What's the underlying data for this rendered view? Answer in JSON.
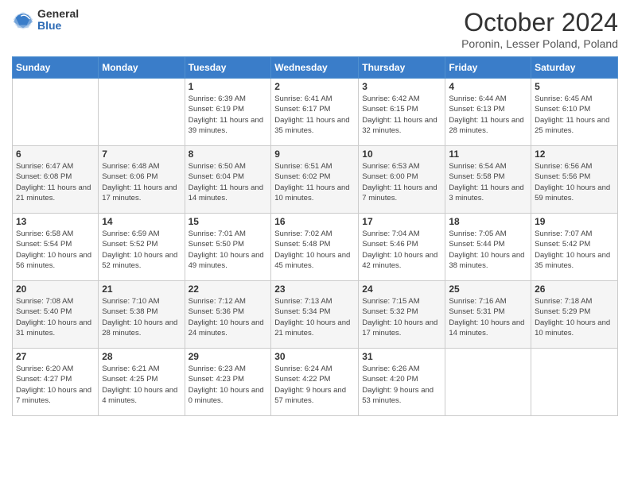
{
  "header": {
    "logo_general": "General",
    "logo_blue": "Blue",
    "month_title": "October 2024",
    "location": "Poronin, Lesser Poland, Poland"
  },
  "weekdays": [
    "Sunday",
    "Monday",
    "Tuesday",
    "Wednesday",
    "Thursday",
    "Friday",
    "Saturday"
  ],
  "weeks": [
    [
      {
        "day": "",
        "info": ""
      },
      {
        "day": "",
        "info": ""
      },
      {
        "day": "1",
        "info": "Sunrise: 6:39 AM\nSunset: 6:19 PM\nDaylight: 11 hours and 39 minutes."
      },
      {
        "day": "2",
        "info": "Sunrise: 6:41 AM\nSunset: 6:17 PM\nDaylight: 11 hours and 35 minutes."
      },
      {
        "day": "3",
        "info": "Sunrise: 6:42 AM\nSunset: 6:15 PM\nDaylight: 11 hours and 32 minutes."
      },
      {
        "day": "4",
        "info": "Sunrise: 6:44 AM\nSunset: 6:13 PM\nDaylight: 11 hours and 28 minutes."
      },
      {
        "day": "5",
        "info": "Sunrise: 6:45 AM\nSunset: 6:10 PM\nDaylight: 11 hours and 25 minutes."
      }
    ],
    [
      {
        "day": "6",
        "info": "Sunrise: 6:47 AM\nSunset: 6:08 PM\nDaylight: 11 hours and 21 minutes."
      },
      {
        "day": "7",
        "info": "Sunrise: 6:48 AM\nSunset: 6:06 PM\nDaylight: 11 hours and 17 minutes."
      },
      {
        "day": "8",
        "info": "Sunrise: 6:50 AM\nSunset: 6:04 PM\nDaylight: 11 hours and 14 minutes."
      },
      {
        "day": "9",
        "info": "Sunrise: 6:51 AM\nSunset: 6:02 PM\nDaylight: 11 hours and 10 minutes."
      },
      {
        "day": "10",
        "info": "Sunrise: 6:53 AM\nSunset: 6:00 PM\nDaylight: 11 hours and 7 minutes."
      },
      {
        "day": "11",
        "info": "Sunrise: 6:54 AM\nSunset: 5:58 PM\nDaylight: 11 hours and 3 minutes."
      },
      {
        "day": "12",
        "info": "Sunrise: 6:56 AM\nSunset: 5:56 PM\nDaylight: 10 hours and 59 minutes."
      }
    ],
    [
      {
        "day": "13",
        "info": "Sunrise: 6:58 AM\nSunset: 5:54 PM\nDaylight: 10 hours and 56 minutes."
      },
      {
        "day": "14",
        "info": "Sunrise: 6:59 AM\nSunset: 5:52 PM\nDaylight: 10 hours and 52 minutes."
      },
      {
        "day": "15",
        "info": "Sunrise: 7:01 AM\nSunset: 5:50 PM\nDaylight: 10 hours and 49 minutes."
      },
      {
        "day": "16",
        "info": "Sunrise: 7:02 AM\nSunset: 5:48 PM\nDaylight: 10 hours and 45 minutes."
      },
      {
        "day": "17",
        "info": "Sunrise: 7:04 AM\nSunset: 5:46 PM\nDaylight: 10 hours and 42 minutes."
      },
      {
        "day": "18",
        "info": "Sunrise: 7:05 AM\nSunset: 5:44 PM\nDaylight: 10 hours and 38 minutes."
      },
      {
        "day": "19",
        "info": "Sunrise: 7:07 AM\nSunset: 5:42 PM\nDaylight: 10 hours and 35 minutes."
      }
    ],
    [
      {
        "day": "20",
        "info": "Sunrise: 7:08 AM\nSunset: 5:40 PM\nDaylight: 10 hours and 31 minutes."
      },
      {
        "day": "21",
        "info": "Sunrise: 7:10 AM\nSunset: 5:38 PM\nDaylight: 10 hours and 28 minutes."
      },
      {
        "day": "22",
        "info": "Sunrise: 7:12 AM\nSunset: 5:36 PM\nDaylight: 10 hours and 24 minutes."
      },
      {
        "day": "23",
        "info": "Sunrise: 7:13 AM\nSunset: 5:34 PM\nDaylight: 10 hours and 21 minutes."
      },
      {
        "day": "24",
        "info": "Sunrise: 7:15 AM\nSunset: 5:32 PM\nDaylight: 10 hours and 17 minutes."
      },
      {
        "day": "25",
        "info": "Sunrise: 7:16 AM\nSunset: 5:31 PM\nDaylight: 10 hours and 14 minutes."
      },
      {
        "day": "26",
        "info": "Sunrise: 7:18 AM\nSunset: 5:29 PM\nDaylight: 10 hours and 10 minutes."
      }
    ],
    [
      {
        "day": "27",
        "info": "Sunrise: 6:20 AM\nSunset: 4:27 PM\nDaylight: 10 hours and 7 minutes."
      },
      {
        "day": "28",
        "info": "Sunrise: 6:21 AM\nSunset: 4:25 PM\nDaylight: 10 hours and 4 minutes."
      },
      {
        "day": "29",
        "info": "Sunrise: 6:23 AM\nSunset: 4:23 PM\nDaylight: 10 hours and 0 minutes."
      },
      {
        "day": "30",
        "info": "Sunrise: 6:24 AM\nSunset: 4:22 PM\nDaylight: 9 hours and 57 minutes."
      },
      {
        "day": "31",
        "info": "Sunrise: 6:26 AM\nSunset: 4:20 PM\nDaylight: 9 hours and 53 minutes."
      },
      {
        "day": "",
        "info": ""
      },
      {
        "day": "",
        "info": ""
      }
    ]
  ]
}
